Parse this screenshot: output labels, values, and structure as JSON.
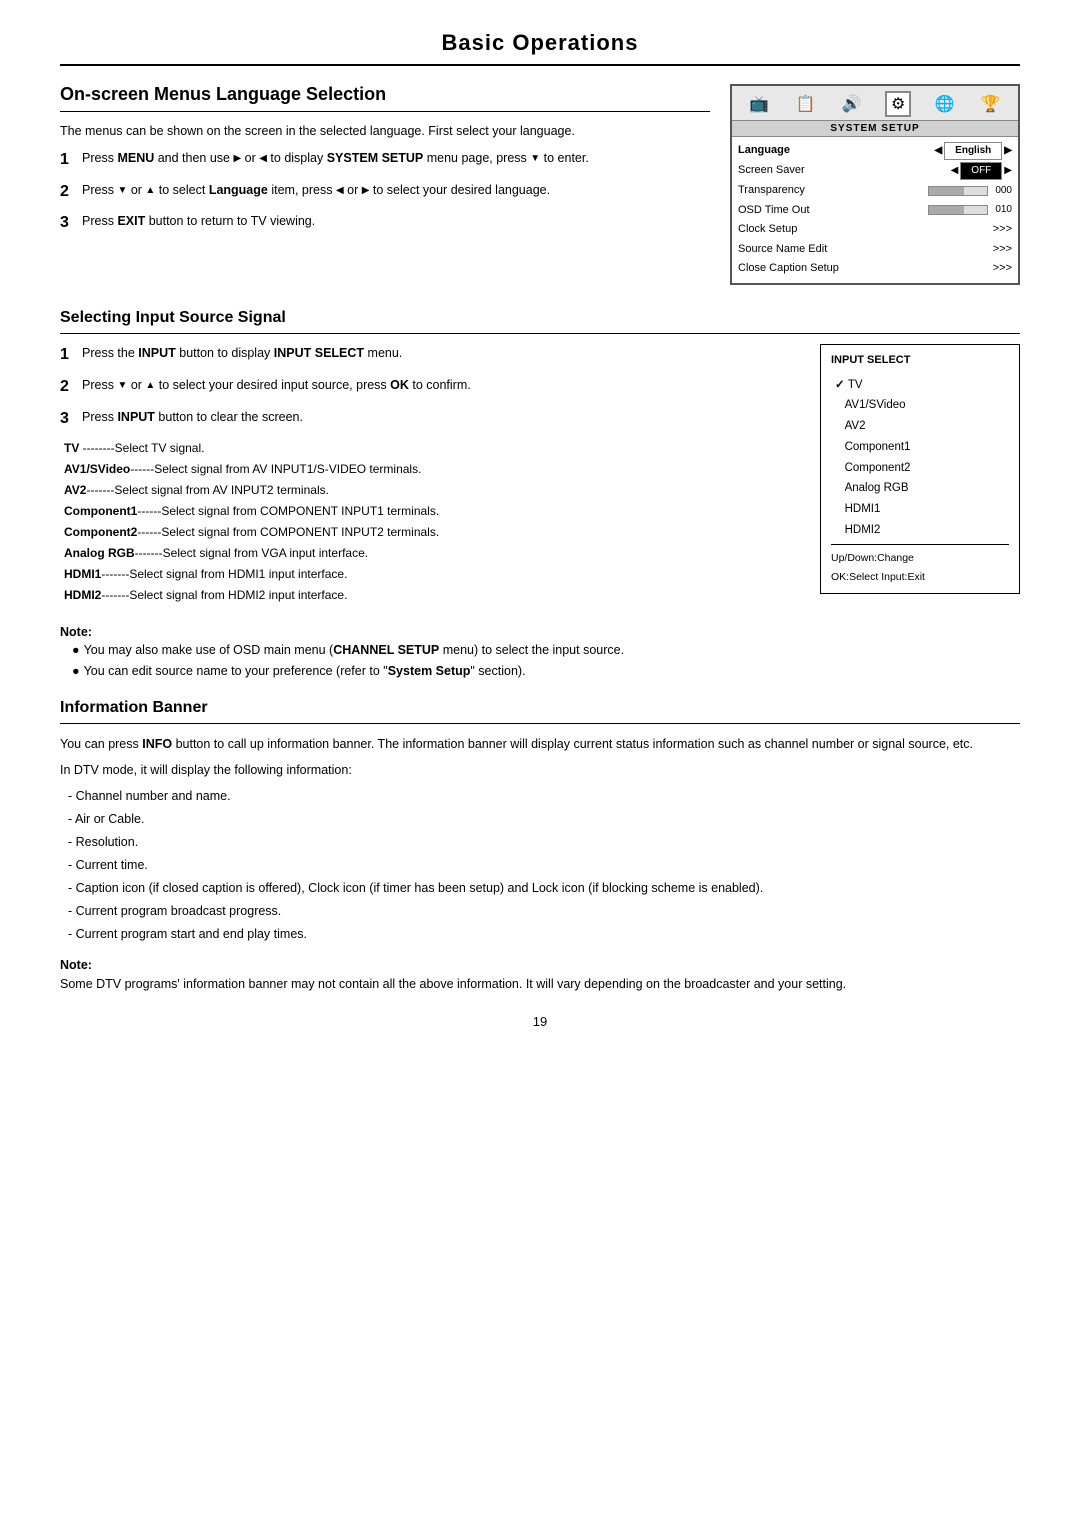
{
  "page": {
    "title": "Basic Operations",
    "page_number": "19"
  },
  "onscreen_section": {
    "heading": "On-screen Menus Language Selection",
    "intro": "The menus can be shown on the screen in the selected language. First select your language.",
    "steps": [
      {
        "num": "1",
        "text_parts": [
          {
            "type": "plain",
            "text": "Press "
          },
          {
            "type": "bold",
            "text": "MENU"
          },
          {
            "type": "plain",
            "text": " and then use "
          },
          {
            "type": "arrow",
            "text": "▶"
          },
          {
            "type": "plain",
            "text": " or "
          },
          {
            "type": "arrow",
            "text": "◀"
          },
          {
            "type": "plain",
            "text": " to display "
          },
          {
            "type": "bold",
            "text": "SYSTEM SETUP"
          },
          {
            "type": "plain",
            "text": " menu page, press "
          },
          {
            "type": "arrow",
            "text": "▼"
          },
          {
            "type": "plain",
            "text": " to enter."
          }
        ]
      },
      {
        "num": "2",
        "text_parts": [
          {
            "type": "plain",
            "text": "Press "
          },
          {
            "type": "arrow",
            "text": "▼"
          },
          {
            "type": "plain",
            "text": " or "
          },
          {
            "type": "arrow",
            "text": "▲"
          },
          {
            "type": "plain",
            "text": " to select "
          },
          {
            "type": "bold",
            "text": "Language"
          },
          {
            "type": "plain",
            "text": " item, press "
          },
          {
            "type": "arrow",
            "text": "◀"
          },
          {
            "type": "plain",
            "text": " or "
          },
          {
            "type": "arrow",
            "text": "▶"
          },
          {
            "type": "plain",
            "text": " to select your desired language."
          }
        ]
      },
      {
        "num": "3",
        "text_parts": [
          {
            "type": "plain",
            "text": "Press "
          },
          {
            "type": "bold",
            "text": "EXIT"
          },
          {
            "type": "plain",
            "text": " button to return to TV viewing."
          }
        ]
      }
    ]
  },
  "system_setup": {
    "label": "SYSTEM SETUP",
    "rows": [
      {
        "key": "Language",
        "val": "English",
        "type": "arrows",
        "bold": true
      },
      {
        "key": "Screen Saver",
        "val": "OFF",
        "type": "arrows_box"
      },
      {
        "key": "Transparency",
        "val": "",
        "type": "bar",
        "num": "000"
      },
      {
        "key": "OSD Time Out",
        "val": "",
        "type": "bar",
        "num": "010"
      },
      {
        "key": "Clock Setup",
        "val": ">>>",
        "type": "plain"
      },
      {
        "key": "Source Name Edit",
        "val": ">>>",
        "type": "plain"
      },
      {
        "key": "Close Caption Setup",
        "val": ">>>",
        "type": "plain"
      }
    ]
  },
  "input_section": {
    "heading": "Selecting Input Source Signal",
    "steps": [
      {
        "num": "1",
        "text": "Press the INPUT button to display INPUT SELECT menu.",
        "bold_parts": [
          "INPUT",
          "INPUT SELECT"
        ]
      },
      {
        "num": "2",
        "text": "Press ▼ or ▲ to select your desired input source, press OK to confirm.",
        "bold_parts": [
          "OK"
        ]
      },
      {
        "num": "3",
        "text": "Press INPUT button to clear the screen.",
        "bold_parts": [
          "INPUT"
        ]
      }
    ],
    "descriptions": [
      {
        "label": "TV",
        "sep": "--------",
        "desc": "Select TV signal."
      },
      {
        "label": "AV1/SVideo",
        "sep": "------",
        "desc": "Select signal from AV INPUT1/S-VIDEO terminals."
      },
      {
        "label": "AV2",
        "sep": "-------",
        "desc": "Select signal from AV INPUT2  terminals."
      },
      {
        "label": "Component1",
        "sep": "------",
        "desc": "Select signal from COMPONENT INPUT1 terminals."
      },
      {
        "label": "Component2",
        "sep": "------",
        "desc": "Select signal from COMPONENT INPUT2 terminals."
      },
      {
        "label": "Analog RGB",
        "sep": "-------",
        "desc": "Select signal from VGA input interface."
      },
      {
        "label": "HDMI1",
        "sep": "-------",
        "desc": "Select signal from HDMI1 input interface."
      },
      {
        "label": "HDMI2",
        "sep": "-------",
        "desc": "Select signal from HDMI2 input interface."
      }
    ],
    "input_select_box": {
      "title": "INPUT SELECT",
      "items": [
        {
          "label": "TV",
          "checked": true
        },
        {
          "label": "AV1/SVideo",
          "checked": false
        },
        {
          "label": "AV2",
          "checked": false
        },
        {
          "label": "Component1",
          "checked": false
        },
        {
          "label": "Component2",
          "checked": false
        },
        {
          "label": "Analog RGB",
          "checked": false
        },
        {
          "label": "HDMI1",
          "checked": false
        },
        {
          "label": "HDMI2",
          "checked": false
        }
      ],
      "footer_line1": "Up/Down:Change",
      "footer_line2": "OK:Select  Input:Exit"
    }
  },
  "note1": {
    "title": "Note:",
    "bullets": [
      "You may also make use of OSD main menu (CHANNEL SETUP menu) to select the input source.",
      "You can edit source name to your preference (refer to \"System Setup\" section)."
    ]
  },
  "info_banner": {
    "heading": "Information Banner",
    "para1": "You can press INFO button to call up information banner. The information banner will display current status information such as channel number or signal source, etc.",
    "para2": "In DTV mode, it will display the following information:",
    "list": [
      "- Channel number and name.",
      "- Air or Cable.",
      "- Resolution.",
      "- Current time.",
      "- Caption icon (if closed caption is offered), Clock icon (if timer has been setup) and Lock icon (if blocking scheme is enabled).",
      "- Current program broadcast progress.",
      "- Current program start and end play times."
    ],
    "note_title": "Note:",
    "note_text": "Some DTV programs' information banner may not contain all the above information. It will vary depending on the broadcaster and your setting."
  }
}
